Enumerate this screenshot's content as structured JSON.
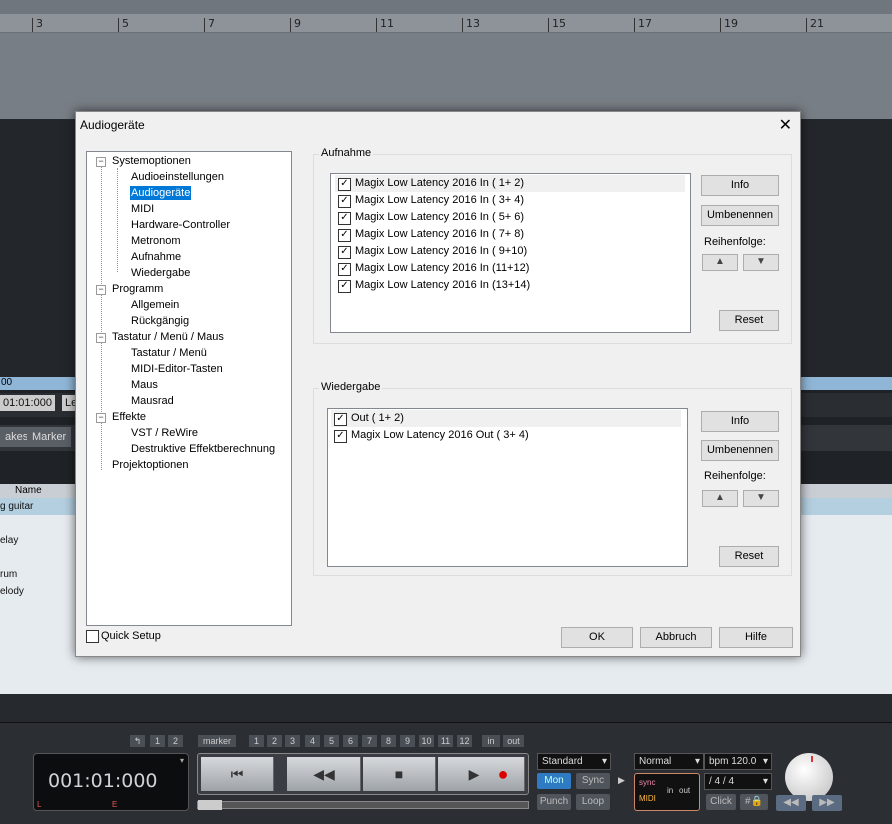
{
  "ruler": {
    "marks": [
      "3",
      "5",
      "7",
      "9",
      "11",
      "13",
      "15",
      "17",
      "19",
      "21"
    ]
  },
  "background": {
    "time_left": "00",
    "time_value": "01:01:000",
    "time_label": "Le",
    "tabs": [
      "akes",
      "Marker"
    ],
    "name_header": "Name",
    "tracks": [
      "g guitar",
      "elay",
      "rum",
      "elody"
    ]
  },
  "dialog": {
    "title": "Audiogeräte",
    "close_label": "✕",
    "tree": [
      {
        "label": "Systemoptionen",
        "level": 0,
        "expander": "−"
      },
      {
        "label": "Audioeinstellungen",
        "level": 1
      },
      {
        "label": "Audiogeräte",
        "level": 1,
        "selected": true
      },
      {
        "label": "MIDI",
        "level": 1
      },
      {
        "label": "Hardware-Controller",
        "level": 1
      },
      {
        "label": "Metronom",
        "level": 1
      },
      {
        "label": "Aufnahme",
        "level": 1
      },
      {
        "label": "Wiedergabe",
        "level": 1
      },
      {
        "label": "Programm",
        "level": 0,
        "expander": "−"
      },
      {
        "label": "Allgemein",
        "level": 1
      },
      {
        "label": "Rückgängig",
        "level": 1
      },
      {
        "label": "Tastatur / Menü / Maus",
        "level": 0,
        "expander": "−"
      },
      {
        "label": "Tastatur / Menü",
        "level": 1
      },
      {
        "label": "MIDI-Editor-Tasten",
        "level": 1
      },
      {
        "label": "Maus",
        "level": 1
      },
      {
        "label": "Mausrad",
        "level": 1
      },
      {
        "label": "Effekte",
        "level": 0,
        "expander": "−"
      },
      {
        "label": "VST / ReWire",
        "level": 1
      },
      {
        "label": "Destruktive Effektberechnung",
        "level": 1
      },
      {
        "label": "Projektoptionen",
        "level": 0
      }
    ],
    "quick_setup": {
      "label": "Quick Setup",
      "checked": false
    },
    "recording": {
      "group_label": "Aufnahme",
      "devices": [
        {
          "label": "Magix Low Latency 2016 In ( 1+ 2)",
          "checked": true
        },
        {
          "label": "Magix Low Latency 2016 In ( 3+ 4)",
          "checked": true
        },
        {
          "label": "Magix Low Latency 2016 In ( 5+ 6)",
          "checked": true
        },
        {
          "label": "Magix Low Latency 2016 In ( 7+ 8)",
          "checked": true
        },
        {
          "label": "Magix Low Latency 2016 In ( 9+10)",
          "checked": true
        },
        {
          "label": "Magix Low Latency 2016 In (11+12)",
          "checked": true
        },
        {
          "label": "Magix Low Latency 2016 In (13+14)",
          "checked": true
        }
      ],
      "info_label": "Info",
      "rename_label": "Umbenennen",
      "order_label": "Reihenfolge:",
      "reset_label": "Reset"
    },
    "playback": {
      "group_label": "Wiedergabe",
      "devices": [
        {
          "label": "Out ( 1+ 2)",
          "checked": true
        },
        {
          "label": "Magix Low Latency 2016 Out ( 3+ 4)",
          "checked": true
        }
      ],
      "info_label": "Info",
      "rename_label": "Umbenennen",
      "order_label": "Reihenfolge:",
      "reset_label": "Reset"
    },
    "ok_label": "OK",
    "cancel_label": "Abbruch",
    "help_label": "Hilfe"
  },
  "transport": {
    "counter": "001:01:000",
    "counter_L": "L",
    "counter_E": "E",
    "marker_label": "marker",
    "marker_numbers": [
      "1",
      "2",
      "3",
      "4",
      "5",
      "6",
      "7",
      "8",
      "9",
      "10",
      "11",
      "12"
    ],
    "left_small": [
      "↰",
      "1",
      "2"
    ],
    "in_label": "in",
    "out_label": "out",
    "mode": "Standard",
    "mon_label": "Mon",
    "sync_label": "Sync",
    "punch_label": "Punch",
    "loop_label": "Loop",
    "tempo_mode": "Normal",
    "bpm": "bpm 120.0",
    "signature": "/   4 / 4",
    "click_label": "Click",
    "sync_small": "sync",
    "midi_small": "MIDI",
    "in_small": "in",
    "out_small": "out"
  }
}
